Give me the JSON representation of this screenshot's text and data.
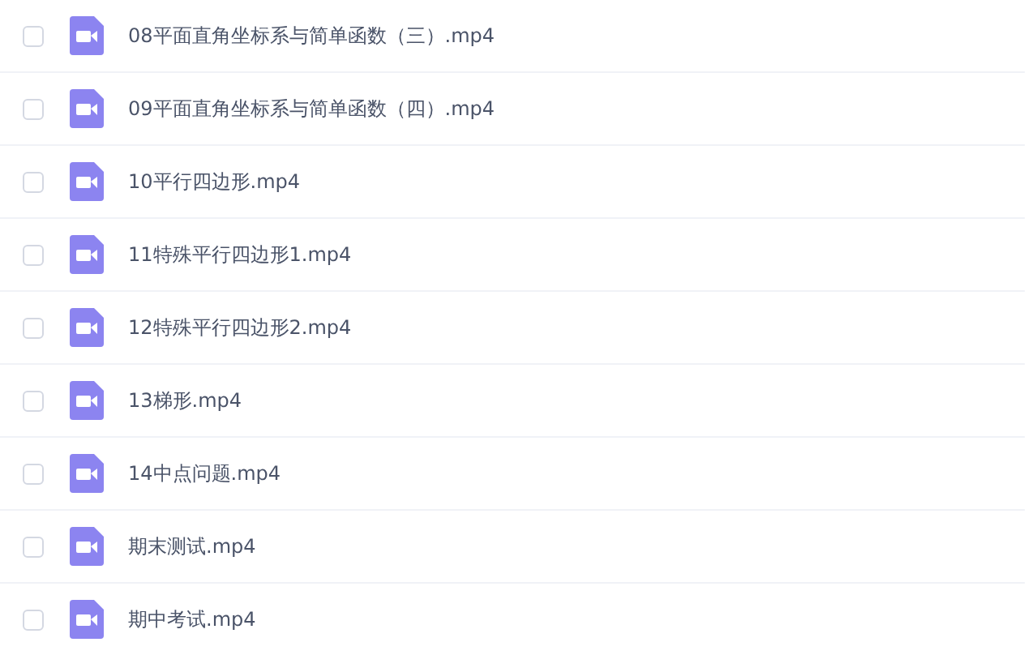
{
  "files": [
    {
      "name": "08平面直角坐标系与简单函数（三）.mp4",
      "checked": false
    },
    {
      "name": "09平面直角坐标系与简单函数（四）.mp4",
      "checked": false
    },
    {
      "name": "10平行四边形.mp4",
      "checked": false
    },
    {
      "name": "11特殊平行四边形1.mp4",
      "checked": false
    },
    {
      "name": "12特殊平行四边形2.mp4",
      "checked": false
    },
    {
      "name": "13梯形.mp4",
      "checked": false
    },
    {
      "name": "14中点问题.mp4",
      "checked": false
    },
    {
      "name": "期末测试.mp4",
      "checked": false
    },
    {
      "name": "期中考试.mp4",
      "checked": false
    }
  ]
}
